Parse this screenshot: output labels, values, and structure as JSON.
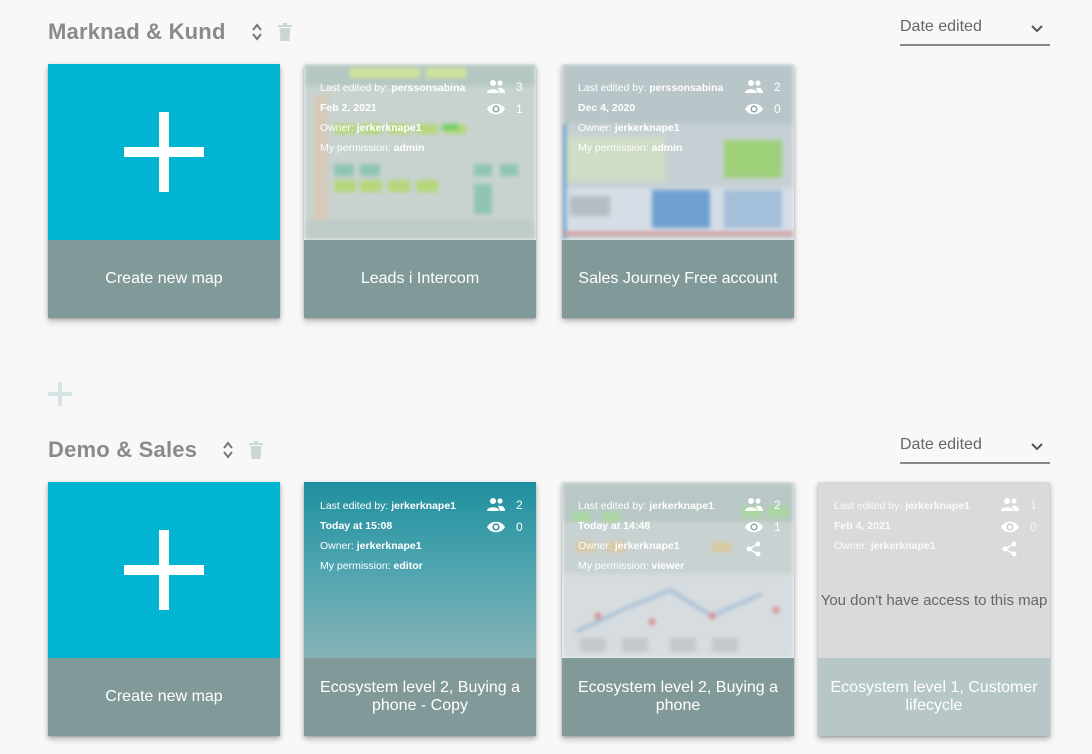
{
  "groups": [
    {
      "title": "Marknad & Kund",
      "sort_label": "Date edited",
      "create_label": "Create new map",
      "maps": [
        {
          "name": "Leads i Intercom",
          "last_edited_by_label": "Last edited by:",
          "last_edited_by": "perssonsabina",
          "date": "Feb 2, 2021",
          "owner_label": "Owner:",
          "owner": "jerkerknape1",
          "permission_label": "My permission:",
          "permission": "admin",
          "collaborators": "3",
          "viewers": "1"
        },
        {
          "name": "Sales Journey Free account",
          "last_edited_by_label": "Last edited by:",
          "last_edited_by": "perssonsabina",
          "date": "Dec 4, 2020",
          "owner_label": "Owner:",
          "owner": "jerkerknape1",
          "permission_label": "My permission:",
          "permission": "admin",
          "collaborators": "2",
          "viewers": "0"
        }
      ]
    },
    {
      "title": "Demo & Sales",
      "sort_label": "Date edited",
      "create_label": "Create new map",
      "maps": [
        {
          "name": "Ecosystem level 2, Buying a phone - Copy",
          "last_edited_by_label": "Last edited by:",
          "last_edited_by": "jerkerknape1",
          "date": "Today at 15:08",
          "owner_label": "Owner:",
          "owner": "jerkerknape1",
          "permission_label": "My permission:",
          "permission": "editor",
          "collaborators": "2",
          "viewers": "0"
        },
        {
          "name": "Ecosystem level 2, Buying a phone",
          "last_edited_by_label": "Last edited by:",
          "last_edited_by": "jerkerknape1",
          "date": "Today at 14:48",
          "owner_label": "Owner:",
          "owner": "jerkerknape1",
          "permission_label": "My permission:",
          "permission": "viewer",
          "collaborators": "2",
          "viewers": "1"
        },
        {
          "name": "Ecosystem level 1, Customer lifecycle",
          "last_edited_by_label": "Last edited by:",
          "last_edited_by": "jerkerknape1",
          "date": "Feb 4, 2021",
          "owner_label": "Owner:",
          "owner": "jerkerknape1",
          "collaborators": "1",
          "viewers": "0",
          "no_access_message": "You don't have access to this map"
        }
      ]
    }
  ],
  "colors": {
    "create_tile": "#00b4d2",
    "card_footer": "#829999",
    "disabled_footer": "#b7c7c7"
  },
  "icons": [
    "sort-icon",
    "trash-icon",
    "chevron-down-icon",
    "people-icon",
    "eye-icon",
    "share-icon",
    "plus-icon"
  ]
}
